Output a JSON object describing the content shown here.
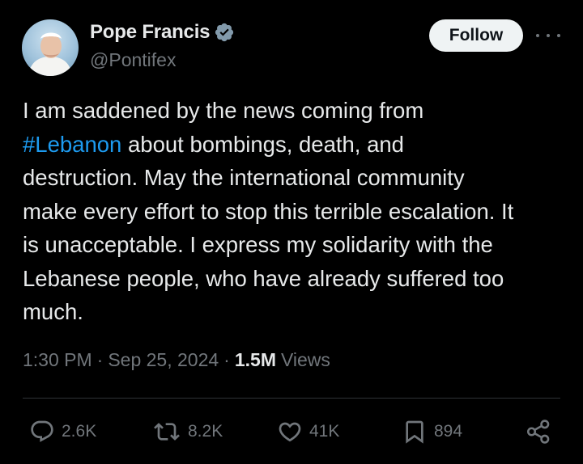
{
  "author": {
    "name": "Pope Francis",
    "handle": "@Pontifex",
    "verified": true,
    "verified_badge_color": "#829aab"
  },
  "header": {
    "follow_label": "Follow",
    "more_icon": "more-icon"
  },
  "tweet": {
    "text_before": "I am saddened by the news coming from\n",
    "hashtag": "#Lebanon",
    "text_after": " about bombings, death, and\ndestruction. May the international community\nmake every effort to stop this terrible escalation. It\nis unacceptable. I express my solidarity with the\nLebanese people, who have already suffered too\nmuch.",
    "hashtag_color": "#1d9bf0"
  },
  "meta": {
    "time": "1:30 PM",
    "separator": "·",
    "date": "Sep 25, 2024",
    "views_count": "1.5M",
    "views_label": "Views"
  },
  "actions": {
    "replies": {
      "icon": "reply-icon",
      "count": "2.6K"
    },
    "reposts": {
      "icon": "repost-icon",
      "count": "8.2K"
    },
    "likes": {
      "icon": "heart-icon",
      "count": "41K"
    },
    "bookmarks": {
      "icon": "bookmark-icon",
      "count": "894"
    },
    "share": {
      "icon": "share-icon"
    }
  },
  "colors": {
    "background": "#000000",
    "text_primary": "#e7e9ea",
    "text_secondary": "#71767b",
    "divider": "#2f3336",
    "follow_bg": "#eff3f4"
  }
}
